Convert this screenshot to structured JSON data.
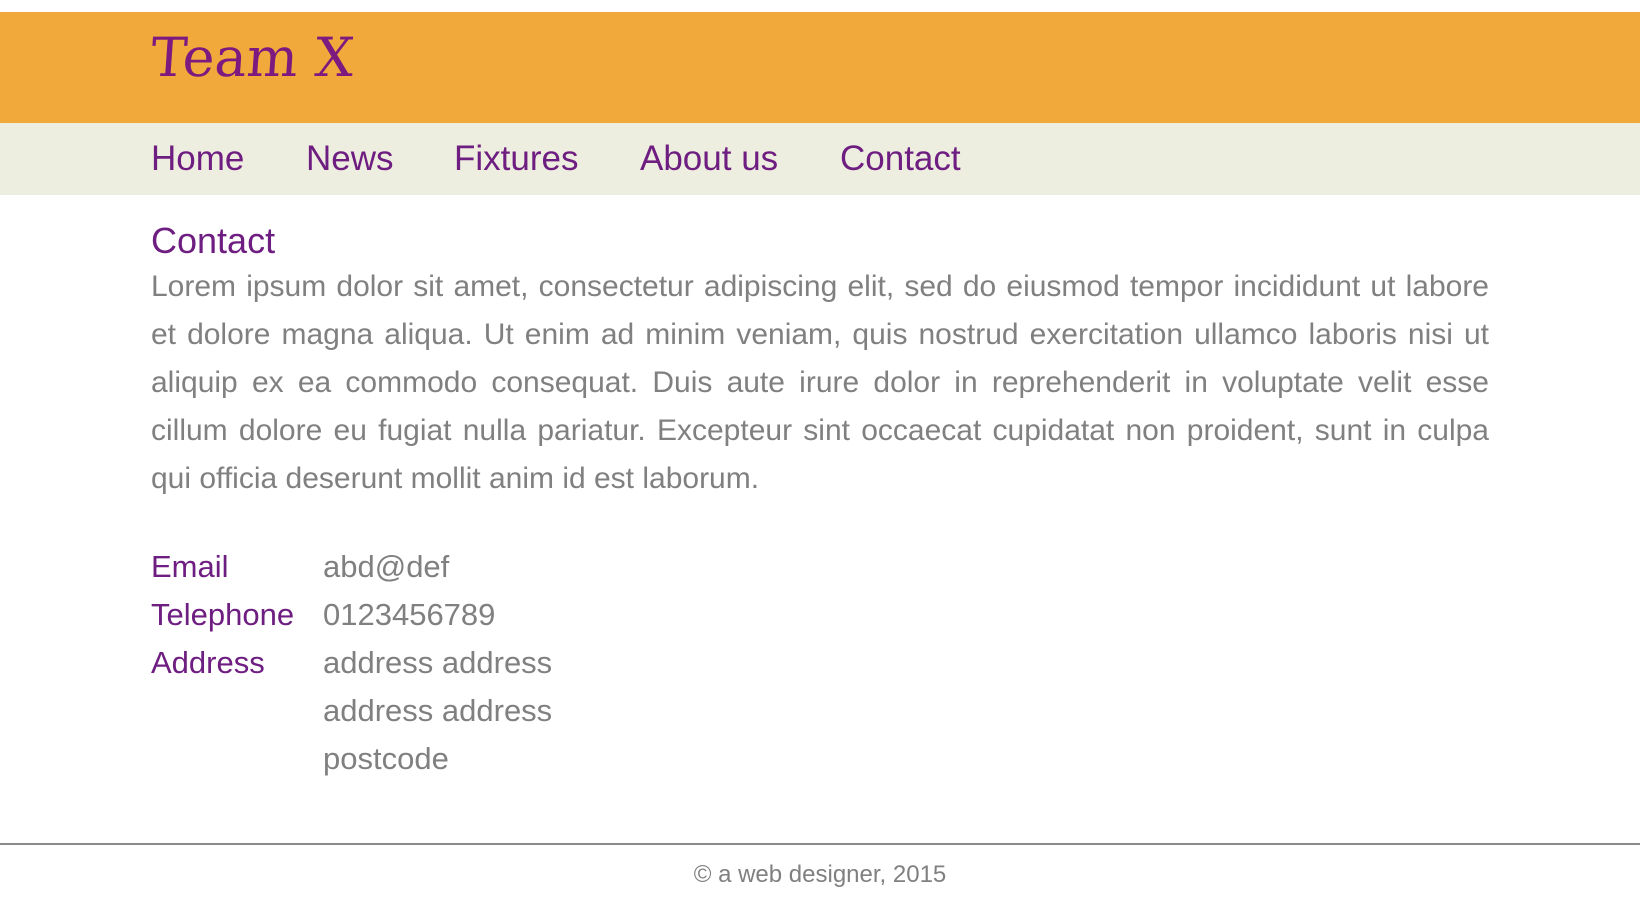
{
  "site": {
    "logo": "Team X"
  },
  "nav": {
    "items": [
      {
        "label": "Home"
      },
      {
        "label": "News"
      },
      {
        "label": "Fixtures"
      },
      {
        "label": "About us"
      },
      {
        "label": "Contact"
      }
    ]
  },
  "page": {
    "title": "Contact",
    "intro": "Lorem ipsum dolor sit amet, consectetur adipiscing elit, sed do eiusmod tempor incididunt ut labore et dolore magna aliqua. Ut enim ad minim veniam, quis nostrud exercitation ullamco laboris nisi ut aliquip ex ea commodo consequat. Duis aute irure dolor in reprehenderit in voluptate velit esse cillum dolore eu fugiat nulla pariatur. Excepteur sint occaecat cupidatat non proident, sunt in culpa qui officia deserunt mollit anim id est laborum."
  },
  "contact": {
    "email_label": "Email",
    "email": "abd@def",
    "telephone_label": "Telephone",
    "telephone": "0123456789",
    "address_label": "Address",
    "address_lines": [
      "address address",
      "address address",
      "postcode"
    ]
  },
  "footer": {
    "text": "© a web designer, 2015"
  },
  "colors": {
    "header_bg": "#f2a93b",
    "nav_bg": "#eeeee0",
    "accent": "#6e1d80",
    "body_text": "#808080"
  }
}
